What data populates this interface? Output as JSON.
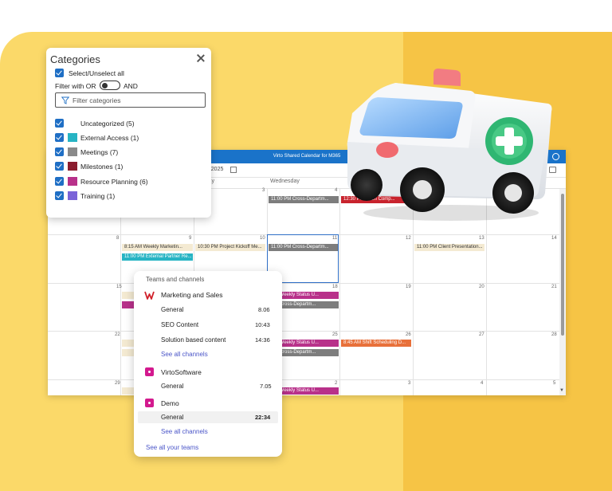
{
  "calendar": {
    "title": "Virto Shared Calendar for M365",
    "date_label": "/1/2025",
    "days": {
      "monday": "lay",
      "wednesday": "Wednesday"
    },
    "day_numbers": [
      "3",
      "4",
      "8",
      "9",
      "10",
      "11",
      "12",
      "13",
      "14",
      "15",
      "18",
      "19",
      "20",
      "21",
      "22",
      "25",
      "26",
      "27",
      "28",
      "29",
      "2",
      "3",
      "4",
      "5"
    ],
    "events": [
      {
        "text": "11:00 PM Cross-Departm...",
        "color": "grey"
      },
      {
        "text": "12:30 PM Team Comp...",
        "color": "red"
      },
      {
        "text": "8:15 AM Weekly Marketin...",
        "color": "beige"
      },
      {
        "text": "11:00 PM External Partner Re...",
        "color": "teal"
      },
      {
        "text": "10:30 PM Project Kickoff Me...",
        "color": "beige"
      },
      {
        "text": "11:00 PM Cross-Departm...",
        "color": "grey"
      },
      {
        "text": "11:00 PM Client Presentation...",
        "color": "beige"
      },
      {
        "text": "PM Weekly Status U...",
        "color": "magenta"
      },
      {
        "text": "PM Cross-Departm...",
        "color": "grey"
      },
      {
        "text": "PM Weekly Status U...",
        "color": "magenta"
      },
      {
        "text": "PM Cross-Departm...",
        "color": "grey"
      },
      {
        "text": "8:45 AM Shift Scheduling D...",
        "color": "orange"
      },
      {
        "text": "PM Weekly Status U...",
        "color": "magenta"
      }
    ]
  },
  "categories": {
    "title": "Categories",
    "select_all": "Select/Unselect all",
    "filter_or": "Filter with OR",
    "filter_and": "AND",
    "filter_placeholder": "Filter categories",
    "items": [
      {
        "label": "Uncategorized (5)",
        "color": ""
      },
      {
        "label": "External Access (1)",
        "color": "#27b4c4"
      },
      {
        "label": "Meetings (7)",
        "color": "#8a8a8a"
      },
      {
        "label": "Milestones (1)",
        "color": "#8b1c2e"
      },
      {
        "label": "Resource Planning (6)",
        "color": "#b8318a"
      },
      {
        "label": "Training (1)",
        "color": "#7a63d8"
      }
    ]
  },
  "teams": {
    "header": "Teams and channels",
    "groups": [
      {
        "name": "Marketing and Sales",
        "channels": [
          {
            "name": "General",
            "time": "8.06"
          },
          {
            "name": "SEO Content",
            "time": "10:43"
          },
          {
            "name": "Solution based content",
            "time": "14:36"
          }
        ],
        "see_all": "See all channels"
      },
      {
        "name": "VirtoSoftware",
        "channels": [
          {
            "name": "General",
            "time": "7.05"
          }
        ]
      },
      {
        "name": "Demo",
        "channels": [
          {
            "name": "General",
            "time": "22:34"
          }
        ],
        "see_all": "See all channels"
      }
    ],
    "see_all_teams": "See all your teams"
  },
  "colors": {
    "accent": "#1f6fc5",
    "titlebar": "#1a73c9",
    "yellow": "#fbd969",
    "yellow_dark": "#f6c445",
    "teams_icon": "#d3198e",
    "link": "#4a55c8"
  }
}
